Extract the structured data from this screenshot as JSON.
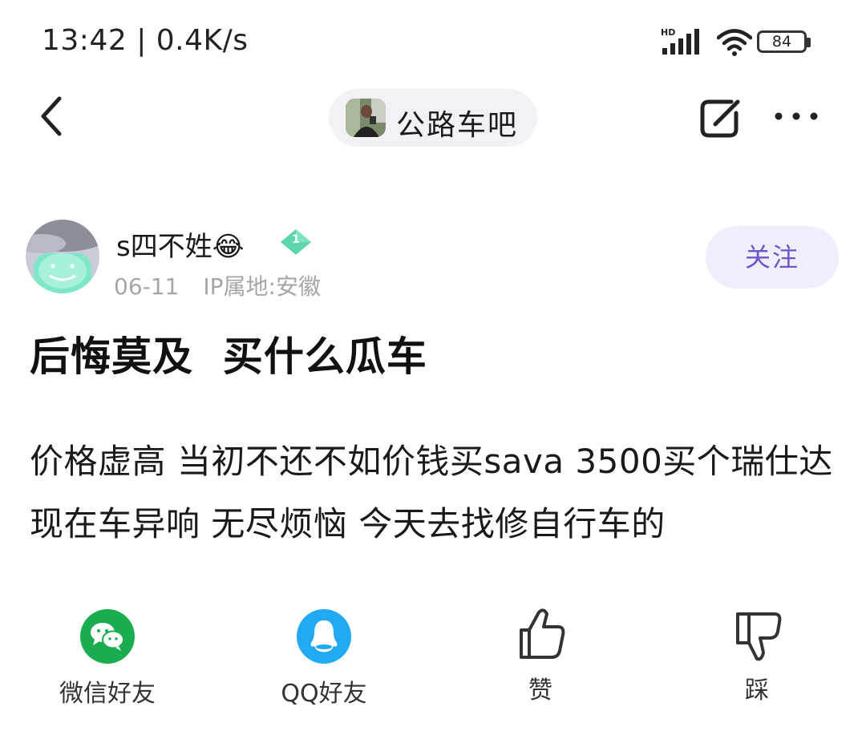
{
  "status_bar": {
    "time_speed": "13:42 | 0.4K/s",
    "network_label": "HD",
    "battery": "84"
  },
  "nav": {
    "forum_name": "公路车吧"
  },
  "post": {
    "author": "s四不姓😂",
    "level": "1",
    "date": "06-11",
    "ip_location": "IP属地:安徽",
    "follow_label": "关注",
    "title": "后悔莫及  买什么瓜车",
    "body": "价格虚高 当初不还不如价钱买sava 3500买个瑞仕达 现在车异响 无尽烦恼 今天去找修自行车的"
  },
  "share_bar": {
    "wechat_label": "微信好友",
    "qq_label": "QQ好友",
    "like_label": "赞",
    "dislike_label": "踩"
  },
  "colors": {
    "accent_purple": "#6e55c8",
    "wechat_green": "#1aad4f",
    "qq_blue": "#1faaf1",
    "level_badge": "#5dd6b0"
  }
}
